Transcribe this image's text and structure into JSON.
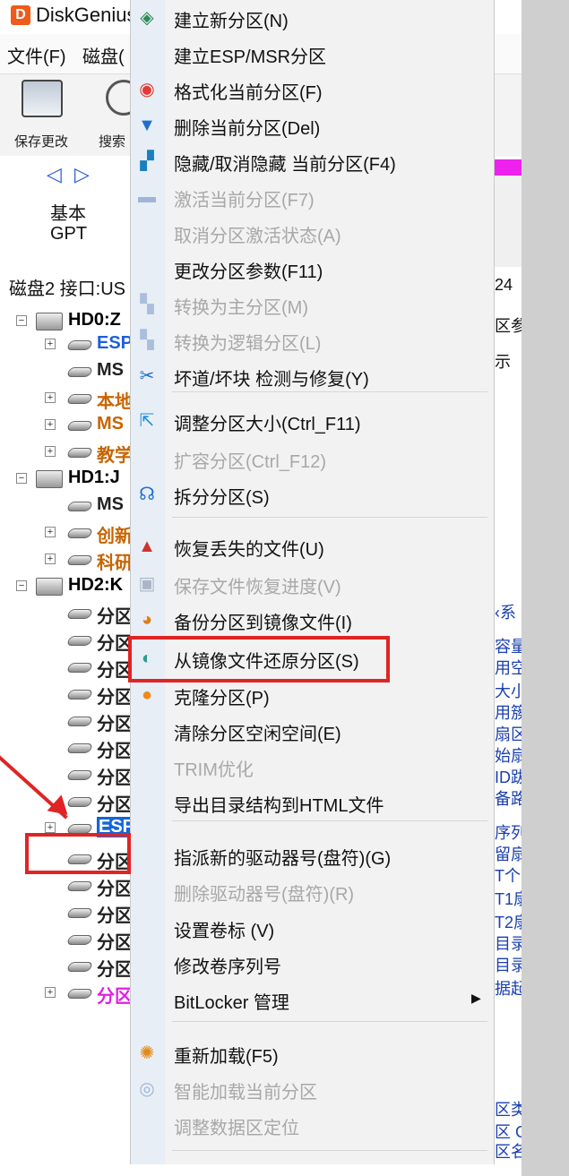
{
  "app": {
    "title": "DiskGenius",
    "logo_letter": "D"
  },
  "menubar": {
    "file": "文件(F)",
    "disk": "磁盘("
  },
  "toolbar": {
    "save_label": "保存更改",
    "search_label": "搜索"
  },
  "disk_nav": {
    "arrows": "◁ ▷",
    "type": "基本",
    "style": "GPT"
  },
  "disk_info": "磁盘2 接口:US",
  "tree": [
    {
      "label": "HD0:Z",
      "kind": "disk",
      "expander": "−",
      "color": "#000000"
    },
    {
      "label": "ESP",
      "kind": "part",
      "expander": "+",
      "color": "#1e5fd6"
    },
    {
      "label": "MS",
      "kind": "part",
      "expander": "",
      "color": "#222222"
    },
    {
      "label": "本地",
      "kind": "part",
      "expander": "+",
      "color": "#c86400"
    },
    {
      "label": "MS",
      "kind": "part",
      "expander": "+",
      "color": "#c86400"
    },
    {
      "label": "教学",
      "kind": "part",
      "expander": "+",
      "color": "#c86400"
    },
    {
      "label": "HD1:J",
      "kind": "disk",
      "expander": "−",
      "color": "#000000"
    },
    {
      "label": "MS",
      "kind": "part",
      "expander": "",
      "color": "#222222"
    },
    {
      "label": "创新",
      "kind": "part",
      "expander": "+",
      "color": "#c86400"
    },
    {
      "label": "科研",
      "kind": "part",
      "expander": "+",
      "color": "#c86400"
    },
    {
      "label": "HD2:K",
      "kind": "disk",
      "expander": "−",
      "color": "#000000"
    },
    {
      "label": "分区",
      "kind": "part",
      "expander": "",
      "color": "#222222"
    },
    {
      "label": "分区",
      "kind": "part",
      "expander": "",
      "color": "#222222"
    },
    {
      "label": "分区",
      "kind": "part",
      "expander": "",
      "color": "#222222"
    },
    {
      "label": "分区",
      "kind": "part",
      "expander": "",
      "color": "#222222"
    },
    {
      "label": "分区",
      "kind": "part",
      "expander": "",
      "color": "#222222"
    },
    {
      "label": "分区",
      "kind": "part",
      "expander": "",
      "color": "#222222"
    },
    {
      "label": "分区",
      "kind": "part",
      "expander": "",
      "color": "#222222"
    },
    {
      "label": "分区",
      "kind": "part",
      "expander": "",
      "color": "#222222"
    },
    {
      "label": "ESP",
      "kind": "part",
      "expander": "+",
      "color": "#ffffff",
      "selected": true
    },
    {
      "label": "分区",
      "kind": "part",
      "expander": "",
      "color": "#222222"
    },
    {
      "label": "分区",
      "kind": "part",
      "expander": "",
      "color": "#222222"
    },
    {
      "label": "分区",
      "kind": "part",
      "expander": "",
      "color": "#222222"
    },
    {
      "label": "分区",
      "kind": "part",
      "expander": "",
      "color": "#222222"
    },
    {
      "label": "分区",
      "kind": "part",
      "expander": "",
      "color": "#222222"
    },
    {
      "label": "分区",
      "kind": "part",
      "expander": "+",
      "color": "#e020e0"
    }
  ],
  "right_fragments": [
    {
      "text": "24",
      "color": "#111111"
    },
    {
      "text": "区参",
      "color": "#111111"
    },
    {
      "text": "示",
      "color": "#111111"
    },
    {
      "text": "‹系",
      "color": "#1a3fb0"
    },
    {
      "text": "容量",
      "color": "#1a3fb0"
    },
    {
      "text": "用空",
      "color": "#1a3fb0"
    },
    {
      "text": "大小",
      "color": "#1a3fb0"
    },
    {
      "text": "用簇",
      "color": "#1a3fb0"
    },
    {
      "text": "扇区",
      "color": "#1a3fb0"
    },
    {
      "text": "始扇",
      "color": "#1a3fb0"
    },
    {
      "text": "ID跋",
      "color": "#1a3fb0"
    },
    {
      "text": "备路",
      "color": "#1a3fb0"
    },
    {
      "text": "序列",
      "color": "#1a3fb0"
    },
    {
      "text": "留扇",
      "color": "#1a3fb0"
    },
    {
      "text": "T个数",
      "color": "#1a3fb0"
    },
    {
      "text": "T1扇",
      "color": "#1a3fb0"
    },
    {
      "text": "T2扇",
      "color": "#1a3fb0"
    },
    {
      "text": "目录",
      "color": "#1a3fb0"
    },
    {
      "text": "目录",
      "color": "#1a3fb0"
    },
    {
      "text": "据起",
      "color": "#1a3fb0"
    },
    {
      "text": "区类",
      "color": "#1a3fb0"
    },
    {
      "text": "区 G",
      "color": "#1a3fb0"
    },
    {
      "text": "区名",
      "color": "#1a3fb0"
    }
  ],
  "menu": {
    "items": [
      {
        "label": "建立新分区(N)",
        "icon": "layers-icon",
        "glyph": "◈",
        "icon_color": "#2e8b57",
        "disabled": false
      },
      {
        "label": "建立ESP/MSR分区",
        "icon": "",
        "glyph": "",
        "icon_color": "",
        "disabled": false
      },
      {
        "label": "格式化当前分区(F)",
        "icon": "lifebuoy-icon",
        "glyph": "◉",
        "icon_color": "#e53935",
        "disabled": false
      },
      {
        "label": "删除当前分区(Del)",
        "icon": "trash-icon",
        "glyph": "▼",
        "icon_color": "#1e6fd0",
        "disabled": false
      },
      {
        "label": "隐藏/取消隐藏 当前分区(F4)",
        "icon": "hide-icon",
        "glyph": "▞",
        "icon_color": "#1a7fbf",
        "disabled": false
      },
      {
        "label": "激活当前分区(F7)",
        "icon": "activate-icon",
        "glyph": "▬",
        "icon_color": "#9fb4d6",
        "disabled": true
      },
      {
        "label": "取消分区激活状态(A)",
        "icon": "",
        "glyph": "",
        "icon_color": "",
        "disabled": true
      },
      {
        "label": "更改分区参数(F11)",
        "icon": "",
        "glyph": "",
        "icon_color": "",
        "disabled": false
      },
      {
        "label": "转换为主分区(M)",
        "icon": "convert-primary-icon",
        "glyph": "▚",
        "icon_color": "#a9bfdc",
        "disabled": true
      },
      {
        "label": "转换为逻辑分区(L)",
        "icon": "convert-logical-icon",
        "glyph": "▚",
        "icon_color": "#a9bfdc",
        "disabled": true
      },
      {
        "label": "坏道/坏块 检测与修复(Y)",
        "icon": "tools-icon",
        "glyph": "✂",
        "icon_color": "#1e6fd0",
        "disabled": false
      },
      {
        "label": "调整分区大小(Ctrl_F11)",
        "icon": "resize-icon",
        "glyph": "⇱",
        "icon_color": "#1a8fd6",
        "disabled": false
      },
      {
        "label": "扩容分区(Ctrl_F12)",
        "icon": "",
        "glyph": "",
        "icon_color": "",
        "disabled": true
      },
      {
        "label": "拆分分区(S)",
        "icon": "split-icon",
        "glyph": "☊",
        "icon_color": "#1e6fd0",
        "disabled": false
      },
      {
        "label": "恢复丢失的文件(U)",
        "icon": "recover-icon",
        "glyph": "▲",
        "icon_color": "#d0342c",
        "disabled": false
      },
      {
        "label": "保存文件恢复进度(V)",
        "icon": "save-progress-icon",
        "glyph": "▣",
        "icon_color": "#aab6c8",
        "disabled": true
      },
      {
        "label": "备份分区到镜像文件(I)",
        "icon": "backup-icon",
        "glyph": "◕",
        "icon_color": "#e07b1a",
        "disabled": false
      },
      {
        "label": "从镜像文件还原分区(S)",
        "icon": "restore-icon",
        "glyph": "◐",
        "icon_color": "#2a9d8f",
        "disabled": false
      },
      {
        "label": "克隆分区(P)",
        "icon": "clone-icon",
        "glyph": "●",
        "icon_color": "#f08a1a",
        "disabled": false
      },
      {
        "label": "清除分区空闲空间(E)",
        "icon": "",
        "glyph": "",
        "icon_color": "",
        "disabled": false
      },
      {
        "label": "TRIM优化",
        "icon": "",
        "glyph": "",
        "icon_color": "",
        "disabled": true
      },
      {
        "label": "导出目录结构到HTML文件",
        "icon": "",
        "glyph": "",
        "icon_color": "",
        "disabled": false
      },
      {
        "label": "指派新的驱动器号(盘符)(G)",
        "icon": "",
        "glyph": "",
        "icon_color": "",
        "disabled": false
      },
      {
        "label": "删除驱动器号(盘符)(R)",
        "icon": "",
        "glyph": "",
        "icon_color": "",
        "disabled": true
      },
      {
        "label": "设置卷标 (V)",
        "icon": "",
        "glyph": "",
        "icon_color": "",
        "disabled": false
      },
      {
        "label": "修改卷序列号",
        "icon": "",
        "glyph": "",
        "icon_color": "",
        "disabled": false
      },
      {
        "label": "BitLocker 管理",
        "icon": "",
        "glyph": "",
        "icon_color": "",
        "disabled": false,
        "submenu": true
      },
      {
        "label": "重新加载(F5)",
        "icon": "reload-icon",
        "glyph": "✺",
        "icon_color": "#e08a1a",
        "disabled": false
      },
      {
        "label": "智能加载当前分区",
        "icon": "smart-load-icon",
        "glyph": "◎",
        "icon_color": "#9fb4d6",
        "disabled": true
      },
      {
        "label": "调整数据区定位",
        "icon": "",
        "glyph": "",
        "icon_color": "",
        "disabled": true
      }
    ]
  }
}
